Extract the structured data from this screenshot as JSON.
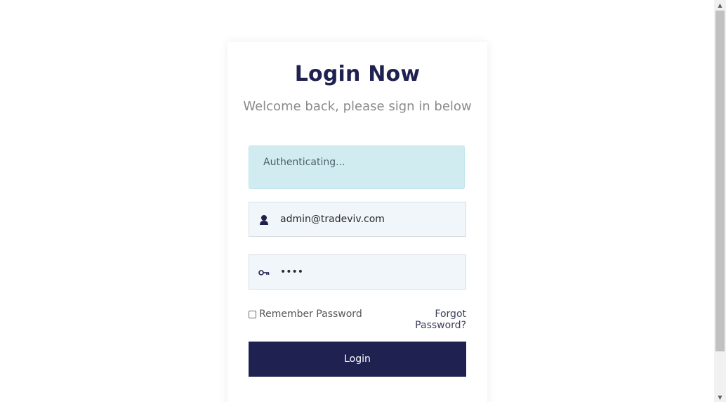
{
  "login": {
    "title": "Login Now",
    "subtitle": "Welcome back, please sign in below",
    "alert_text": "Authenticating...",
    "email_value": "admin@tradeviv.com",
    "password_value": "••••",
    "remember_label": "Remember Password",
    "remember_checked": false,
    "forgot_label": "Forgot Password?",
    "login_button": "Login"
  },
  "icons": {
    "email": "user-icon",
    "password": "key-icon"
  },
  "colors": {
    "brand": "#1f2150",
    "alert_bg": "#d1ecf1",
    "field_bg": "#f1f6fb",
    "subtitle": "#8a8a8a"
  },
  "scrollbar": {
    "up_glyph": "▲",
    "down_glyph": "▼"
  }
}
